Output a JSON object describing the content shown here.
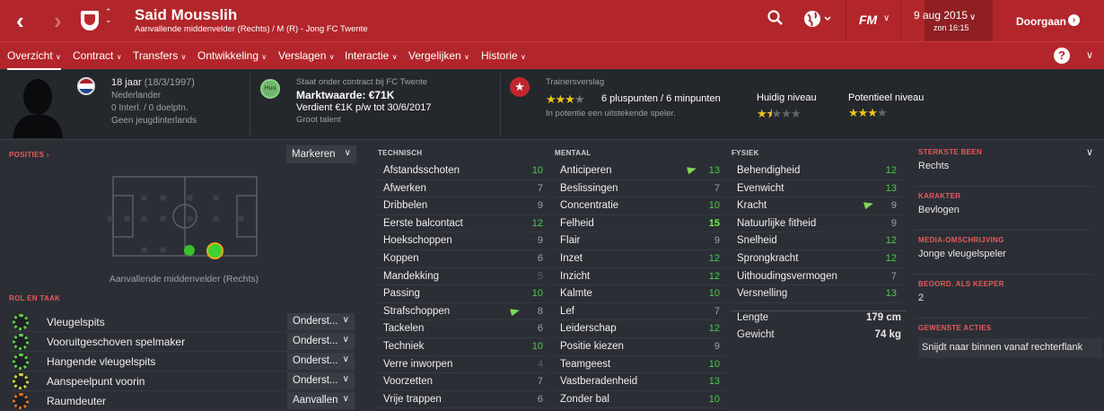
{
  "topbar": {
    "back_icon": "chevron-left-icon",
    "forward_icon": "chevron-right-icon",
    "player_name": "Said Mousslih",
    "player_subtitle": "Aanvallende middenvelder (Rechts) / M (R) - Jong FC Twente",
    "fm_label": "FM",
    "date": "9 aug 2015",
    "time": "zon 16:15",
    "continue_label": "Doorgaan"
  },
  "nav": {
    "items": [
      "Overzicht",
      "Contract",
      "Transfers",
      "Ontwikkeling",
      "Verslagen",
      "Interactie",
      "Vergelijken",
      "Historie"
    ]
  },
  "header": {
    "age": "18 jaar",
    "dob": "(18/3/1997)",
    "nationality": "Nederlander",
    "caps": "0 Interl. / 0 doelptn.",
    "youth_caps": "Geen jeugdinterlands",
    "contract_badge": "Huu",
    "contract_text": "Staat onder contract bij FC Twente",
    "value": "Marktwaarde: €71K",
    "wage": "Verdient €1K p/w tot 30/6/2017",
    "potential_tag": "Groot talent",
    "report_title": "Trainersverslag",
    "report_points": "6 pluspunten / 6 minpunten",
    "report_note": "In potentie een uitstekende speler.",
    "current_label": "Huidig niveau",
    "potential_label": "Potentieel niveau",
    "report_stars": 3,
    "current_stars": 1.5,
    "potential_stars": 3
  },
  "positions": {
    "title": "POSITIES",
    "mark_label": "Markeren",
    "position_label": "Aanvallende middenvelder (Rechts)"
  },
  "roles": {
    "title": "ROL EN TAAK",
    "items": [
      {
        "name": "Vleugelspits",
        "duty": "Onderst..."
      },
      {
        "name": "Vooruitgeschoven spelmaker",
        "duty": "Onderst..."
      },
      {
        "name": "Hangende vleugelspits",
        "duty": "Onderst..."
      },
      {
        "name": "Aanspeelpunt voorin",
        "duty": "Onderst..."
      },
      {
        "name": "Raumdeuter",
        "duty": "Aanvallen"
      }
    ]
  },
  "technical": {
    "title": "TECHNISCH",
    "attrs": [
      {
        "name": "Afstandsschoten",
        "value": "10"
      },
      {
        "name": "Afwerken",
        "value": "7"
      },
      {
        "name": "Dribbelen",
        "value": "9"
      },
      {
        "name": "Eerste balcontact",
        "value": "12"
      },
      {
        "name": "Hoekschoppen",
        "value": "9"
      },
      {
        "name": "Koppen",
        "value": "6"
      },
      {
        "name": "Mandekking",
        "value": "5"
      },
      {
        "name": "Passing",
        "value": "10"
      },
      {
        "name": "Strafschoppen",
        "value": "8"
      },
      {
        "name": "Tackelen",
        "value": "6"
      },
      {
        "name": "Techniek",
        "value": "10"
      },
      {
        "name": "Verre inworpen",
        "value": "4"
      },
      {
        "name": "Voorzetten",
        "value": "7"
      },
      {
        "name": "Vrije trappen",
        "value": "6"
      }
    ]
  },
  "mental": {
    "title": "MENTAAL",
    "attrs": [
      {
        "name": "Anticiperen",
        "value": "13"
      },
      {
        "name": "Beslissingen",
        "value": "7"
      },
      {
        "name": "Concentratie",
        "value": "10"
      },
      {
        "name": "Felheid",
        "value": "15"
      },
      {
        "name": "Flair",
        "value": "9"
      },
      {
        "name": "Inzet",
        "value": "12"
      },
      {
        "name": "Inzicht",
        "value": "12"
      },
      {
        "name": "Kalmte",
        "value": "10"
      },
      {
        "name": "Lef",
        "value": "7"
      },
      {
        "name": "Leiderschap",
        "value": "12"
      },
      {
        "name": "Positie kiezen",
        "value": "9"
      },
      {
        "name": "Teamgeest",
        "value": "10"
      },
      {
        "name": "Vastberadenheid",
        "value": "13"
      },
      {
        "name": "Zonder bal",
        "value": "10"
      }
    ]
  },
  "physical": {
    "title": "FYSIEK",
    "attrs": [
      {
        "name": "Behendigheid",
        "value": "12"
      },
      {
        "name": "Evenwicht",
        "value": "13"
      },
      {
        "name": "Kracht",
        "value": "9"
      },
      {
        "name": "Natuurlijke fitheid",
        "value": "9"
      },
      {
        "name": "Snelheid",
        "value": "12"
      },
      {
        "name": "Sprongkracht",
        "value": "12"
      },
      {
        "name": "Uithoudingsvermogen",
        "value": "7"
      },
      {
        "name": "Versnelling",
        "value": "13"
      }
    ],
    "height_label": "Lengte",
    "height_value": "179 cm",
    "weight_label": "Gewicht",
    "weight_value": "74 kg"
  },
  "right": {
    "foot_title": "STERKSTE BEEN",
    "foot_value": "Rechts",
    "char_title": "KARAKTER",
    "char_value": "Bevlogen",
    "media_title": "MEDIA-OMSCHRIJVING",
    "media_value": "Jonge vleugelspeler",
    "keeper_title": "BEOORD. ALS KEEPER",
    "keeper_value": "2",
    "actions_title": "GEWENSTE ACTIES",
    "actions_value": "Snijdt naar binnen vanaf rechterflank"
  },
  "colors": {
    "accent": "#b2262b",
    "good": "#4ec94e",
    "star": "#f0c419"
  }
}
